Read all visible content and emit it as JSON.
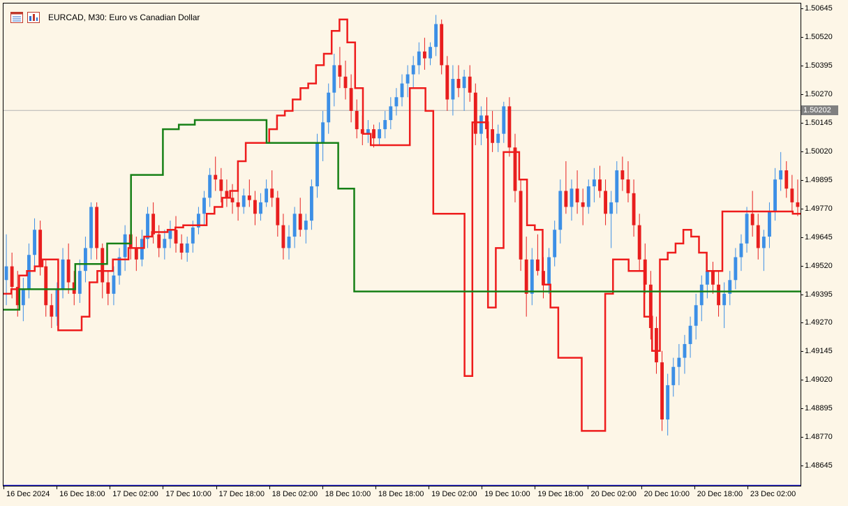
{
  "window": {
    "symbol_title": "EURCAD, M30:  Euro vs Canadian Dollar",
    "toolbar_icons": [
      "table-icon",
      "chart-properties-icon"
    ]
  },
  "chart_data": {
    "type": "line",
    "title": "EURCAD, M30:  Euro vs Canadian Dollar",
    "instrument": "EURCAD",
    "timeframe": "M30",
    "ylim": [
      1.4856,
      1.5067
    ],
    "y_ticks": [
      "1.50645",
      "1.50520",
      "1.50395",
      "1.50270",
      "1.50145",
      "1.50020",
      "1.49895",
      "1.49770",
      "1.49645",
      "1.49520",
      "1.49395",
      "1.49270",
      "1.49145",
      "1.49020",
      "1.48895",
      "1.48770",
      "1.48645"
    ],
    "x_ticks": [
      "16 Dec 2024",
      "16 Dec 18:00",
      "17 Dec 02:00",
      "17 Dec 10:00",
      "17 Dec 18:00",
      "18 Dec 02:00",
      "18 Dec 10:00",
      "18 Dec 18:00",
      "19 Dec 02:00",
      "19 Dec 10:00",
      "19 Dec 18:00",
      "20 Dec 02:00",
      "20 Dec 10:00",
      "20 Dec 18:00",
      "23 Dec 02:00"
    ],
    "current_price": "1.50202",
    "current_price_value": 1.50202,
    "grid": false,
    "colors": {
      "background": "#fdf6e7",
      "bull": "#3c8fe6",
      "bear": "#e81e1e",
      "fast_line": "#ee1c1c",
      "mid_line": "#168016",
      "slow_line": "#1a1ad0",
      "current_price_line": "#b4b4b4"
    },
    "candles": [
      [
        1.4946,
        1.4966,
        1.4935,
        1.4952
      ],
      [
        1.4952,
        1.4958,
        1.4938,
        1.4943
      ],
      [
        1.4943,
        1.495,
        1.493,
        1.4935
      ],
      [
        1.4935,
        1.4947,
        1.4928,
        1.4942
      ],
      [
        1.4942,
        1.4962,
        1.4938,
        1.4957
      ],
      [
        1.4957,
        1.4973,
        1.495,
        1.4968
      ],
      [
        1.4968,
        1.4972,
        1.4948,
        1.4952
      ],
      [
        1.4952,
        1.4955,
        1.493,
        1.4935
      ],
      [
        1.4935,
        1.494,
        1.4925,
        1.493
      ],
      [
        1.493,
        1.4945,
        1.4926,
        1.4942
      ],
      [
        1.4942,
        1.496,
        1.4938,
        1.4955
      ],
      [
        1.4955,
        1.4962,
        1.494,
        1.4945
      ],
      [
        1.4945,
        1.495,
        1.4935,
        1.494
      ],
      [
        1.494,
        1.4955,
        1.4936,
        1.495
      ],
      [
        1.495,
        1.4965,
        1.4945,
        1.496
      ],
      [
        1.496,
        1.498,
        1.4955,
        1.4978
      ],
      [
        1.4978,
        1.498,
        1.4955,
        1.496
      ],
      [
        1.496,
        1.4962,
        1.4938,
        1.4945
      ],
      [
        1.4945,
        1.495,
        1.4935,
        1.494
      ],
      [
        1.494,
        1.4952,
        1.4935,
        1.4948
      ],
      [
        1.4948,
        1.496,
        1.4944,
        1.4956
      ],
      [
        1.4956,
        1.497,
        1.495,
        1.4966
      ],
      [
        1.4966,
        1.4972,
        1.4955,
        1.496
      ],
      [
        1.496,
        1.4965,
        1.495,
        1.4955
      ],
      [
        1.4955,
        1.4968,
        1.4952,
        1.4964
      ],
      [
        1.4964,
        1.4978,
        1.496,
        1.4975
      ],
      [
        1.4975,
        1.498,
        1.4962,
        1.4966
      ],
      [
        1.4966,
        1.497,
        1.4956,
        1.496
      ],
      [
        1.496,
        1.4968,
        1.4955,
        1.4964
      ],
      [
        1.4964,
        1.4972,
        1.496,
        1.4968
      ],
      [
        1.4968,
        1.4974,
        1.4958,
        1.4962
      ],
      [
        1.4962,
        1.4966,
        1.4955,
        1.4958
      ],
      [
        1.4958,
        1.4965,
        1.4954,
        1.4962
      ],
      [
        1.4962,
        1.4972,
        1.4958,
        1.4969
      ],
      [
        1.4969,
        1.4978,
        1.4966,
        1.4975
      ],
      [
        1.4975,
        1.4985,
        1.497,
        1.4982
      ],
      [
        1.4982,
        1.4995,
        1.4978,
        1.4992
      ],
      [
        1.4992,
        1.5,
        1.4985,
        1.499
      ],
      [
        1.499,
        1.4995,
        1.498,
        1.4985
      ],
      [
        1.4985,
        1.499,
        1.4978,
        1.4982
      ],
      [
        1.4982,
        1.4988,
        1.4975,
        1.498
      ],
      [
        1.498,
        1.4985,
        1.4972,
        1.4978
      ],
      [
        1.4978,
        1.4986,
        1.4975,
        1.4983
      ],
      [
        1.4983,
        1.499,
        1.4978,
        1.4981
      ],
      [
        1.4981,
        1.4985,
        1.497,
        1.4975
      ],
      [
        1.4975,
        1.4984,
        1.4972,
        1.498
      ],
      [
        1.498,
        1.499,
        1.4978,
        1.4986
      ],
      [
        1.4986,
        1.4994,
        1.4978,
        1.4982
      ],
      [
        1.4982,
        1.4985,
        1.4965,
        1.497
      ],
      [
        1.497,
        1.4975,
        1.4955,
        1.496
      ],
      [
        1.496,
        1.497,
        1.4955,
        1.4965
      ],
      [
        1.4965,
        1.4978,
        1.496,
        1.4975
      ],
      [
        1.4975,
        1.4982,
        1.4965,
        1.4968
      ],
      [
        1.4968,
        1.4975,
        1.4962,
        1.4972
      ],
      [
        1.4972,
        1.499,
        1.4968,
        1.4987
      ],
      [
        1.4987,
        1.501,
        1.4982,
        1.5006
      ],
      [
        1.5006,
        1.502,
        1.4998,
        1.5015
      ],
      [
        1.5015,
        1.5032,
        1.501,
        1.5028
      ],
      [
        1.5028,
        1.5045,
        1.5022,
        1.504
      ],
      [
        1.504,
        1.5048,
        1.503,
        1.5035
      ],
      [
        1.5035,
        1.5042,
        1.5025,
        1.503
      ],
      [
        1.503,
        1.5036,
        1.5015,
        1.502
      ],
      [
        1.502,
        1.5025,
        1.5008,
        1.5012
      ],
      [
        1.5012,
        1.5018,
        1.5005,
        1.501
      ],
      [
        1.501,
        1.5016,
        1.5006,
        1.5012
      ],
      [
        1.5012,
        1.5014,
        1.5004,
        1.5008
      ],
      [
        1.5008,
        1.5015,
        1.5005,
        1.5012
      ],
      [
        1.5012,
        1.502,
        1.5008,
        1.5016
      ],
      [
        1.5016,
        1.5026,
        1.5012,
        1.5022
      ],
      [
        1.5022,
        1.503,
        1.5018,
        1.5026
      ],
      [
        1.5026,
        1.5036,
        1.5022,
        1.5032
      ],
      [
        1.5032,
        1.504,
        1.5026,
        1.5036
      ],
      [
        1.5036,
        1.5044,
        1.503,
        1.504
      ],
      [
        1.504,
        1.505,
        1.5036,
        1.5046
      ],
      [
        1.5046,
        1.5052,
        1.5038,
        1.5043
      ],
      [
        1.5043,
        1.505,
        1.504,
        1.5048
      ],
      [
        1.5048,
        1.5062,
        1.5044,
        1.5058
      ],
      [
        1.5058,
        1.506,
        1.5036,
        1.504
      ],
      [
        1.504,
        1.5044,
        1.502,
        1.5025
      ],
      [
        1.5025,
        1.504,
        1.5018,
        1.5034
      ],
      [
        1.5034,
        1.504,
        1.5026,
        1.503
      ],
      [
        1.503,
        1.5038,
        1.502,
        1.5035
      ],
      [
        1.5035,
        1.504,
        1.5024,
        1.5028
      ],
      [
        1.5028,
        1.5032,
        1.5005,
        1.501
      ],
      [
        1.501,
        1.5022,
        1.5005,
        1.5018
      ],
      [
        1.5018,
        1.5026,
        1.5008,
        1.5012
      ],
      [
        1.5012,
        1.502,
        1.5002,
        1.5006
      ],
      [
        1.5006,
        1.5014,
        1.5002,
        1.501
      ],
      [
        1.501,
        1.5024,
        1.5006,
        1.5022
      ],
      [
        1.5022,
        1.5026,
        1.5,
        1.5004
      ],
      [
        1.5004,
        1.501,
        1.498,
        1.4985
      ],
      [
        1.4985,
        1.499,
        1.495,
        1.4955
      ],
      [
        1.4955,
        1.4965,
        1.493,
        1.494
      ],
      [
        1.494,
        1.496,
        1.4935,
        1.4955
      ],
      [
        1.4955,
        1.4966,
        1.4948,
        1.495
      ],
      [
        1.495,
        1.4956,
        1.4938,
        1.4944
      ],
      [
        1.4944,
        1.496,
        1.494,
        1.4956
      ],
      [
        1.4956,
        1.4972,
        1.4952,
        1.4968
      ],
      [
        1.4968,
        1.499,
        1.4962,
        1.4985
      ],
      [
        1.4985,
        1.4998,
        1.4975,
        1.4978
      ],
      [
        1.4978,
        1.499,
        1.4972,
        1.4986
      ],
      [
        1.4986,
        1.4994,
        1.4975,
        1.498
      ],
      [
        1.498,
        1.4986,
        1.497,
        1.4978
      ],
      [
        1.4978,
        1.499,
        1.4975,
        1.4987
      ],
      [
        1.4987,
        1.4995,
        1.498,
        1.499
      ],
      [
        1.499,
        1.4996,
        1.4982,
        1.4985
      ],
      [
        1.4985,
        1.499,
        1.497,
        1.4975
      ],
      [
        1.4975,
        1.4985,
        1.496,
        1.498
      ],
      [
        1.498,
        1.4998,
        1.4975,
        1.4994
      ],
      [
        1.4994,
        1.5,
        1.4985,
        1.499
      ],
      [
        1.499,
        1.4998,
        1.498,
        1.4984
      ],
      [
        1.4984,
        1.499,
        1.4965,
        1.497
      ],
      [
        1.497,
        1.4975,
        1.495,
        1.4955
      ],
      [
        1.4955,
        1.4962,
        1.494,
        1.4944
      ],
      [
        1.4944,
        1.495,
        1.492,
        1.4925
      ],
      [
        1.4925,
        1.493,
        1.4905,
        1.491
      ],
      [
        1.491,
        1.4915,
        1.488,
        1.4885
      ],
      [
        1.4885,
        1.4905,
        1.4878,
        1.49
      ],
      [
        1.49,
        1.4912,
        1.4895,
        1.4908
      ],
      [
        1.4908,
        1.4918,
        1.49,
        1.4912
      ],
      [
        1.4912,
        1.4922,
        1.4905,
        1.4918
      ],
      [
        1.4918,
        1.493,
        1.4912,
        1.4926
      ],
      [
        1.4926,
        1.494,
        1.492,
        1.4935
      ],
      [
        1.4935,
        1.4948,
        1.4928,
        1.4944
      ],
      [
        1.4944,
        1.4955,
        1.4938,
        1.495
      ],
      [
        1.495,
        1.4954,
        1.494,
        1.4944
      ],
      [
        1.4944,
        1.495,
        1.493,
        1.4935
      ],
      [
        1.4935,
        1.4945,
        1.4925,
        1.494
      ],
      [
        1.494,
        1.495,
        1.4935,
        1.4946
      ],
      [
        1.4946,
        1.496,
        1.4942,
        1.4956
      ],
      [
        1.4956,
        1.4966,
        1.495,
        1.4962
      ],
      [
        1.4962,
        1.4978,
        1.4958,
        1.4975
      ],
      [
        1.4975,
        1.4985,
        1.4965,
        1.497
      ],
      [
        1.497,
        1.4975,
        1.4955,
        1.496
      ],
      [
        1.496,
        1.4968,
        1.495,
        1.4965
      ],
      [
        1.4965,
        1.498,
        1.496,
        1.4976
      ],
      [
        1.4976,
        1.4995,
        1.4972,
        1.499
      ],
      [
        1.499,
        1.5002,
        1.4985,
        1.4994
      ],
      [
        1.4994,
        1.4998,
        1.4982,
        1.4986
      ],
      [
        1.4986,
        1.4992,
        1.4976,
        1.498
      ],
      [
        1.498,
        1.499,
        1.4974,
        1.4978
      ]
    ],
    "series": [
      {
        "name": "",
        "color": "#ee1c1c",
        "values": [
          1.494,
          1.4942,
          1.4948,
          1.495,
          1.4952,
          1.4955,
          1.4955,
          1.4924,
          1.4924,
          1.4924,
          1.493,
          1.4945,
          1.495,
          1.495,
          1.4955,
          1.4955,
          1.496,
          1.496,
          1.4965,
          1.4967,
          1.4967,
          1.4968,
          1.4969,
          1.497,
          1.497,
          1.497,
          1.4975,
          1.4978,
          1.4982,
          1.4985,
          1.4998,
          1.5006,
          1.5006,
          1.5006,
          1.5012,
          1.5018,
          1.502,
          1.5025,
          1.503,
          1.5032,
          1.504,
          1.5045,
          1.5055,
          1.506,
          1.505,
          1.503,
          1.501,
          1.5005,
          1.5005,
          1.5005,
          1.5005,
          1.5005,
          1.503,
          1.503,
          1.502,
          1.4975,
          1.4975,
          1.4975,
          1.4975,
          1.4904,
          1.5015,
          1.5015,
          1.4934,
          1.496,
          1.5002,
          1.5002,
          1.499,
          1.497,
          1.4968,
          1.4944,
          1.4934,
          1.4912,
          1.4912,
          1.4912,
          1.488,
          1.488,
          1.488,
          1.494,
          1.4955,
          1.4955,
          1.495,
          1.495,
          1.493,
          1.4915,
          1.4955,
          1.4958,
          1.4962,
          1.4968,
          1.4965,
          1.4958,
          1.495,
          1.495,
          1.4976,
          1.4976,
          1.4976,
          1.4976,
          1.4976,
          1.4976,
          1.4976,
          1.4976,
          1.4976,
          1.4975
        ]
      },
      {
        "name": "",
        "color": "#168016",
        "values": [
          1.4933,
          1.4933,
          1.4942,
          1.4942,
          1.4942,
          1.4942,
          1.4942,
          1.4942,
          1.4942,
          1.4953,
          1.4953,
          1.4953,
          1.4953,
          1.4962,
          1.4962,
          1.4962,
          1.4992,
          1.4992,
          1.4992,
          1.4992,
          1.5012,
          1.5012,
          1.5014,
          1.5014,
          1.5016,
          1.5016,
          1.5016,
          1.5016,
          1.5016,
          1.5016,
          1.5016,
          1.5016,
          1.5016,
          1.5006,
          1.5006,
          1.5006,
          1.5006,
          1.5006,
          1.5006,
          1.5006,
          1.5006,
          1.5006,
          1.4986,
          1.4986,
          1.4941,
          1.4941,
          1.4941,
          1.4941,
          1.4941,
          1.4941,
          1.4941,
          1.4941,
          1.4941,
          1.4941,
          1.4941,
          1.4941,
          1.4941,
          1.4941,
          1.4941,
          1.4941,
          1.4941,
          1.4941,
          1.4941,
          1.4941,
          1.4941,
          1.4941,
          1.4941,
          1.4941,
          1.4941,
          1.4941,
          1.4941,
          1.4941,
          1.4941,
          1.4941,
          1.4941,
          1.4941,
          1.4941,
          1.4941,
          1.4941,
          1.4941,
          1.4941,
          1.4941,
          1.4941,
          1.4941,
          1.4941,
          1.4941,
          1.4941,
          1.4941,
          1.4941,
          1.4941,
          1.4941,
          1.4941,
          1.4941,
          1.4941,
          1.4941,
          1.4941,
          1.4941,
          1.4941,
          1.4941,
          1.4941
        ]
      },
      {
        "name": "",
        "color": "#1a1ad0",
        "values": [
          1.4856,
          1.4856,
          1.4856,
          1.4856,
          1.4856,
          1.4856,
          1.4856,
          1.4856,
          1.4856,
          1.4856,
          1.4856,
          1.4856,
          1.4856,
          1.4856,
          1.4856,
          1.4856,
          1.4856,
          1.4856,
          1.4856,
          1.4856
        ]
      }
    ]
  }
}
